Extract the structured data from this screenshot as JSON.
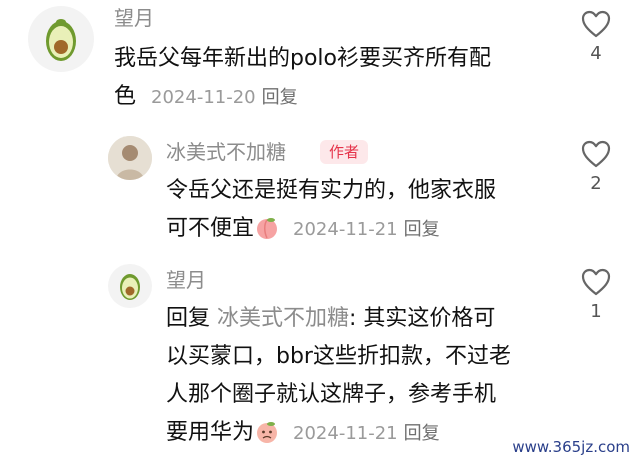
{
  "comments": [
    {
      "username": "望月",
      "text_line1": "我岳父每年新出的polo衫要买齐所有配",
      "text_line2": "色",
      "date": "2024-11-20",
      "reply_label": "回复",
      "likes": "4"
    },
    {
      "username": "冰美式不加糖",
      "badge": "作者",
      "text_line1": "令岳父还是挺有实力的，他家衣服",
      "text_line2": "可不便宜",
      "emoji": "peach-emoji",
      "date": "2024-11-21",
      "reply_label": "回复",
      "likes": "2"
    },
    {
      "username": "望月",
      "reply_prefix": "回复",
      "reply_to": "冰美式不加糖",
      "text_line1_rest": ": 其实这价格可",
      "text_line2": "以买蒙口，bbr这些折扣款，不过老",
      "text_line3": "人那个圈子就认这牌子，参考手机",
      "text_line4": "要用华为",
      "emoji": "crying-peach-emoji",
      "date": "2024-11-21",
      "reply_label": "回复",
      "likes": "1"
    }
  ],
  "watermark": "www.365jz.com",
  "colors": {
    "author_badge_bg": "#fde8ea",
    "author_badge_text": "#e5334a",
    "meta_gray": "#9a9a9a",
    "avocado_green": "#7fa83a"
  }
}
